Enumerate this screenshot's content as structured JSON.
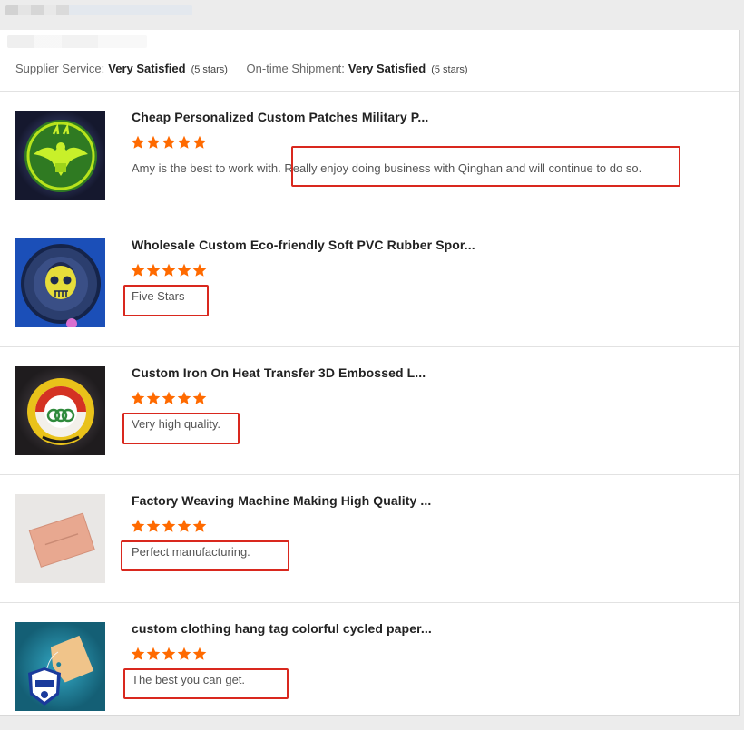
{
  "summary": {
    "supplier_label": "Supplier Service:",
    "supplier_value": "Very Satisfied",
    "supplier_stars": "(5 stars)",
    "shipment_label": "On-time Shipment:",
    "shipment_value": "Very Satisfied",
    "shipment_stars": "(5 stars)"
  },
  "colors": {
    "star": "#ff6a00",
    "highlight_box": "#d9281e"
  },
  "reviews": [
    {
      "title": "Cheap Personalized Custom Patches Military P...",
      "rating": 5,
      "comment": "Amy is the best to work with. Really enjoy doing business with Qinghan and will continue to do so.",
      "image": "eagle-patch-thumbnail"
    },
    {
      "title": "Wholesale Custom Eco-friendly Soft PVC Rubber Spor...",
      "rating": 5,
      "comment": "Five Stars",
      "image": "pvc-skull-patch-thumbnail"
    },
    {
      "title": "Custom Iron On Heat Transfer 3D Embossed L...",
      "rating": 5,
      "comment": "Very high quality.",
      "image": "club-badge-thumbnail"
    },
    {
      "title": "Factory Weaving Machine Making High Quality ...",
      "rating": 5,
      "comment": "Perfect manufacturing.",
      "image": "woven-label-thumbnail"
    },
    {
      "title": "custom clothing hang tag colorful cycled paper...",
      "rating": 5,
      "comment": "The best you can get.",
      "image": "hang-tag-thumbnail"
    }
  ]
}
